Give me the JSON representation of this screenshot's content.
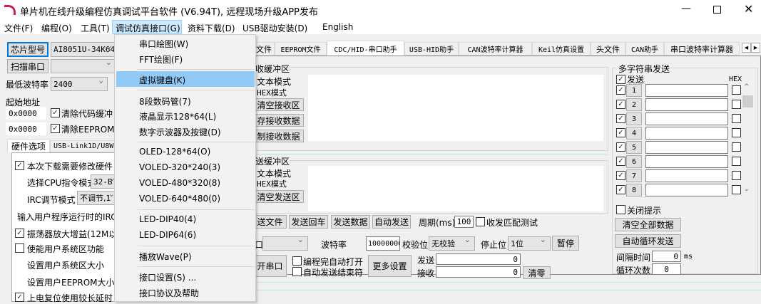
{
  "title": "单片机在线升级编程仿真调试平台软件 (V6.94T), 远程现场升级APP发布",
  "menubar": [
    "文件(F)",
    "编程(O)",
    "工具(T)",
    "调试仿真接口(G)",
    "资料下载(D)",
    "USB驱动安装(D)",
    "English"
  ],
  "dropdown": [
    "串口绘图(W)",
    "FFT绘图(F)",
    "虚拟键盘(K)",
    "8段数码管(7)",
    "液晶显示128*64(L)",
    "数字示波器及按键(D)",
    "OLED-128*64(O)",
    "VOLED-320*240(3)",
    "VOLED-480*320(8)",
    "VOLED-640*480(0)",
    "LED-DIP40(4)",
    "LED-DIP64(6)",
    "播放Wave(P)",
    "接口设置(S) ...",
    "接口协议及帮助"
  ],
  "left": {
    "chip_btn": "芯片型号",
    "chip_value": "AI8051U-34K64",
    "scan_btn": "扫描串口",
    "baud_label": "最低波特率",
    "baud_value": "2400",
    "start_addr": "起始地址",
    "addr1": "0x0000",
    "addr2": "0x0000",
    "clear_code": "清除代码缓冲",
    "clear_eeprom": "清除EEPROM缓",
    "tabs": [
      "硬件选项",
      "USB-Link1D/U8W"
    ],
    "opts": {
      "o1": "本次下载需要修改硬件",
      "cpu": "选择CPU指令模式",
      "cpu_val": "32-B",
      "irc": "IRC调节模式",
      "irc_val": "不调节,1",
      "irc_input": "输入用户程序运行时的IRC",
      "osc": "振荡器放大增益(12M以",
      "sys": "使能用户系统区功能",
      "sys_size": "设置用户系统区大小",
      "eep_size": "设置用户EEPROM大小",
      "reset": "上电复位使用较长延时"
    }
  },
  "tabs": [
    "文件",
    "EEPROM文件",
    "CDC/HID-串口助手",
    "USB-HID助手",
    "CAN波特率计算器",
    "Keil仿真设置",
    "头文件",
    "CAN助手",
    "串口波特率计算器"
  ],
  "serial": {
    "rx_group": "收缓冲区",
    "text_mode": "文本模式",
    "hex_mode": "HEX模式",
    "clear_rx": "清空接收区",
    "save_rx": "存接收数据",
    "copy_rx": "制接收数据",
    "tx_group": "送缓冲区",
    "clear_tx": "清空发送区",
    "send_file": "送文件",
    "send_cr": "发送回车",
    "send_data": "发送数据",
    "auto_send": "自动发送",
    "period": "周期(ms)",
    "period_val": "100",
    "match_test": "收发匹配测试",
    "port_label": "口",
    "baud": "波特率",
    "baud_val": "10000000",
    "parity": "校验位",
    "parity_val": "无校验",
    "stop": "停止位",
    "stop_val": "1位",
    "pause": "暂停",
    "open": "开串口",
    "auto_open": "编程完自动打开",
    "auto_end": "自动发送结束符",
    "more": "更多设置",
    "tx_label": "发送",
    "tx_count": "0",
    "rx_label": "接收",
    "rx_count": "0",
    "reset": "清零"
  },
  "multi": {
    "title": "多字符串发送",
    "send": "发送",
    "hex": "HEX",
    "rows": [
      "1",
      "2",
      "3",
      "4",
      "5",
      "6",
      "7",
      "8"
    ],
    "close_tip": "关闭提示",
    "clear_all": "清空全部数据",
    "auto_loop": "自动循环发送",
    "interval": "间隔时间",
    "interval_val": "0",
    "ms": "ms",
    "loops": "循环次数",
    "loops_val": "0"
  }
}
